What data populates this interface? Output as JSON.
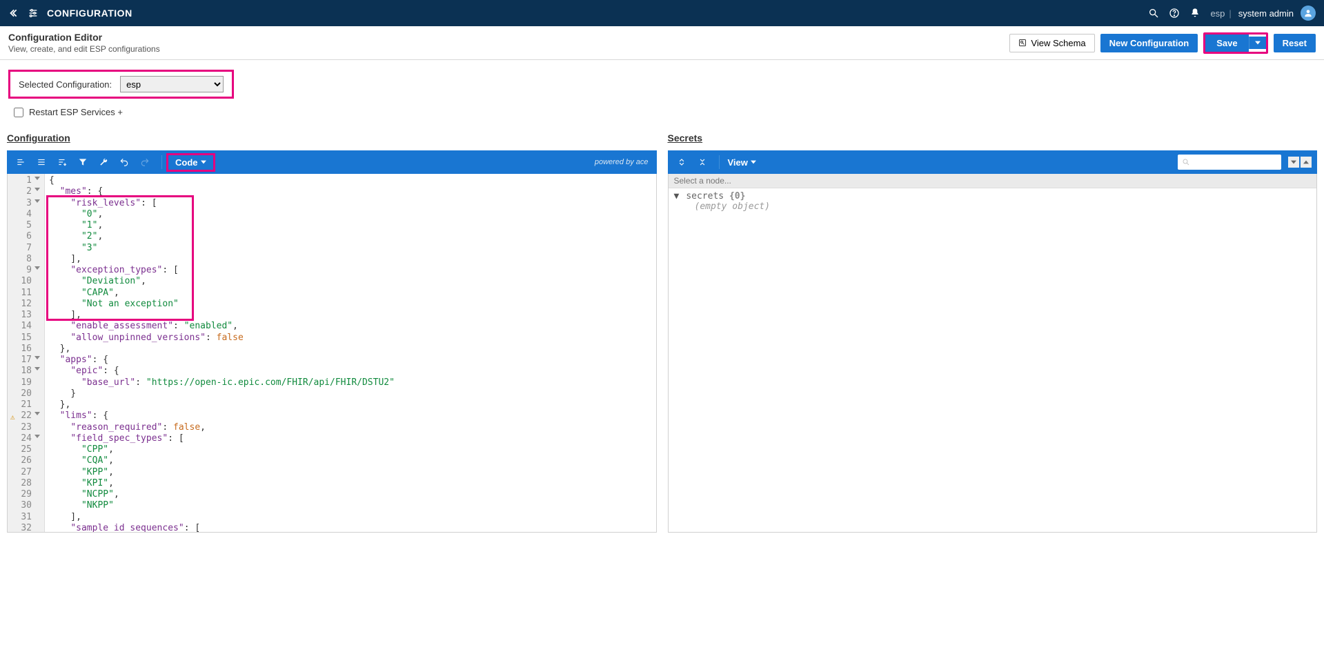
{
  "header": {
    "title": "CONFIGURATION",
    "esp_label": "esp",
    "username": "system admin"
  },
  "page": {
    "title": "Configuration Editor",
    "subtitle": "View, create, and edit ESP configurations"
  },
  "buttons": {
    "view_schema": "View Schema",
    "new_config": "New Configuration",
    "save": "Save",
    "reset": "Reset"
  },
  "selected_config": {
    "label": "Selected Configuration:",
    "value": "esp"
  },
  "restart_label": "Restart ESP Services +",
  "panes": {
    "left_title": "Configuration",
    "right_title": "Secrets"
  },
  "left_toolbar": {
    "code_label": "Code",
    "powered": "powered by ace"
  },
  "right_toolbar": {
    "view_label": "View"
  },
  "secrets": {
    "select_prompt": "Select a node...",
    "root_key": "secrets",
    "root_count": "{0}",
    "empty_label": "(empty object)"
  },
  "code_lines": [
    {
      "n": 1,
      "fold": true,
      "raw": "{"
    },
    {
      "n": 2,
      "fold": true,
      "raw": "  \"mes\": {",
      "segs": [
        {
          "t": "  "
        },
        {
          "t": "\"mes\"",
          "c": "key"
        },
        {
          "t": ": {"
        }
      ]
    },
    {
      "n": 3,
      "fold": true,
      "raw": "    \"risk_levels\": [",
      "segs": [
        {
          "t": "    "
        },
        {
          "t": "\"risk_levels\"",
          "c": "key"
        },
        {
          "t": ": ["
        }
      ]
    },
    {
      "n": 4,
      "raw": "      \"0\",",
      "segs": [
        {
          "t": "      "
        },
        {
          "t": "\"0\"",
          "c": "str"
        },
        {
          "t": ","
        }
      ]
    },
    {
      "n": 5,
      "raw": "      \"1\",",
      "segs": [
        {
          "t": "      "
        },
        {
          "t": "\"1\"",
          "c": "str"
        },
        {
          "t": ","
        }
      ]
    },
    {
      "n": 6,
      "raw": "      \"2\",",
      "segs": [
        {
          "t": "      "
        },
        {
          "t": "\"2\"",
          "c": "str"
        },
        {
          "t": ","
        }
      ]
    },
    {
      "n": 7,
      "raw": "      \"3\"",
      "segs": [
        {
          "t": "      "
        },
        {
          "t": "\"3\"",
          "c": "str"
        }
      ]
    },
    {
      "n": 8,
      "raw": "    ],",
      "segs": [
        {
          "t": "    ],"
        }
      ]
    },
    {
      "n": 9,
      "fold": true,
      "raw": "    \"exception_types\": [",
      "segs": [
        {
          "t": "    "
        },
        {
          "t": "\"exception_types\"",
          "c": "key"
        },
        {
          "t": ": ["
        }
      ]
    },
    {
      "n": 10,
      "raw": "      \"Deviation\",",
      "segs": [
        {
          "t": "      "
        },
        {
          "t": "\"Deviation\"",
          "c": "str"
        },
        {
          "t": ","
        }
      ]
    },
    {
      "n": 11,
      "raw": "      \"CAPA\",",
      "segs": [
        {
          "t": "      "
        },
        {
          "t": "\"CAPA\"",
          "c": "str"
        },
        {
          "t": ","
        }
      ]
    },
    {
      "n": 12,
      "raw": "      \"Not an exception\"",
      "segs": [
        {
          "t": "      "
        },
        {
          "t": "\"Not an exception\"",
          "c": "str"
        }
      ]
    },
    {
      "n": 13,
      "raw": "    ],",
      "segs": [
        {
          "t": "    ],"
        }
      ]
    },
    {
      "n": 14,
      "raw": "    \"enable_assessment\": \"enabled\",",
      "segs": [
        {
          "t": "    "
        },
        {
          "t": "\"enable_assessment\"",
          "c": "key"
        },
        {
          "t": ": "
        },
        {
          "t": "\"enabled\"",
          "c": "str"
        },
        {
          "t": ","
        }
      ]
    },
    {
      "n": 15,
      "raw": "    \"allow_unpinned_versions\": false",
      "segs": [
        {
          "t": "    "
        },
        {
          "t": "\"allow_unpinned_versions\"",
          "c": "key"
        },
        {
          "t": ": "
        },
        {
          "t": "false",
          "c": "kw"
        }
      ]
    },
    {
      "n": 16,
      "raw": "  },",
      "segs": [
        {
          "t": "  },"
        }
      ]
    },
    {
      "n": 17,
      "fold": true,
      "raw": "  \"apps\": {",
      "segs": [
        {
          "t": "  "
        },
        {
          "t": "\"apps\"",
          "c": "key"
        },
        {
          "t": ": {"
        }
      ]
    },
    {
      "n": 18,
      "fold": true,
      "raw": "    \"epic\": {",
      "segs": [
        {
          "t": "    "
        },
        {
          "t": "\"epic\"",
          "c": "key"
        },
        {
          "t": ": {"
        }
      ]
    },
    {
      "n": 19,
      "raw": "      \"base_url\": \"https://open-ic.epic.com/FHIR/api/FHIR/DSTU2\"",
      "segs": [
        {
          "t": "      "
        },
        {
          "t": "\"base_url\"",
          "c": "key"
        },
        {
          "t": ": "
        },
        {
          "t": "\"https://open-ic.epic.com/FHIR/api/FHIR/DSTU2\"",
          "c": "str"
        }
      ]
    },
    {
      "n": 20,
      "raw": "    }",
      "segs": [
        {
          "t": "    }"
        }
      ]
    },
    {
      "n": 21,
      "raw": "  },",
      "segs": [
        {
          "t": "  },"
        }
      ]
    },
    {
      "n": 22,
      "fold": true,
      "warn": true,
      "raw": "  \"lims\": {",
      "segs": [
        {
          "t": "  "
        },
        {
          "t": "\"lims\"",
          "c": "key"
        },
        {
          "t": ": {"
        }
      ]
    },
    {
      "n": 23,
      "raw": "    \"reason_required\": false,",
      "segs": [
        {
          "t": "    "
        },
        {
          "t": "\"reason_required\"",
          "c": "key"
        },
        {
          "t": ": "
        },
        {
          "t": "false",
          "c": "kw"
        },
        {
          "t": ","
        }
      ]
    },
    {
      "n": 24,
      "fold": true,
      "raw": "    \"field_spec_types\": [",
      "segs": [
        {
          "t": "    "
        },
        {
          "t": "\"field_spec_types\"",
          "c": "key"
        },
        {
          "t": ": ["
        }
      ]
    },
    {
      "n": 25,
      "raw": "      \"CPP\",",
      "segs": [
        {
          "t": "      "
        },
        {
          "t": "\"CPP\"",
          "c": "str"
        },
        {
          "t": ","
        }
      ]
    },
    {
      "n": 26,
      "raw": "      \"CQA\",",
      "segs": [
        {
          "t": "      "
        },
        {
          "t": "\"CQA\"",
          "c": "str"
        },
        {
          "t": ","
        }
      ]
    },
    {
      "n": 27,
      "raw": "      \"KPP\",",
      "segs": [
        {
          "t": "      "
        },
        {
          "t": "\"KPP\"",
          "c": "str"
        },
        {
          "t": ","
        }
      ]
    },
    {
      "n": 28,
      "raw": "      \"KPI\",",
      "segs": [
        {
          "t": "      "
        },
        {
          "t": "\"KPI\"",
          "c": "str"
        },
        {
          "t": ","
        }
      ]
    },
    {
      "n": 29,
      "raw": "      \"NCPP\",",
      "segs": [
        {
          "t": "      "
        },
        {
          "t": "\"NCPP\"",
          "c": "str"
        },
        {
          "t": ","
        }
      ]
    },
    {
      "n": 30,
      "raw": "      \"NKPP\"",
      "segs": [
        {
          "t": "      "
        },
        {
          "t": "\"NKPP\"",
          "c": "str"
        }
      ]
    },
    {
      "n": 31,
      "raw": "    ],",
      "segs": [
        {
          "t": "    ],"
        }
      ]
    },
    {
      "n": 32,
      "raw": "    \"sample_id_sequences\": [",
      "segs": [
        {
          "t": "    "
        },
        {
          "t": "\"sample_id_sequences\"",
          "c": "key"
        },
        {
          "t": ": ["
        }
      ]
    }
  ]
}
